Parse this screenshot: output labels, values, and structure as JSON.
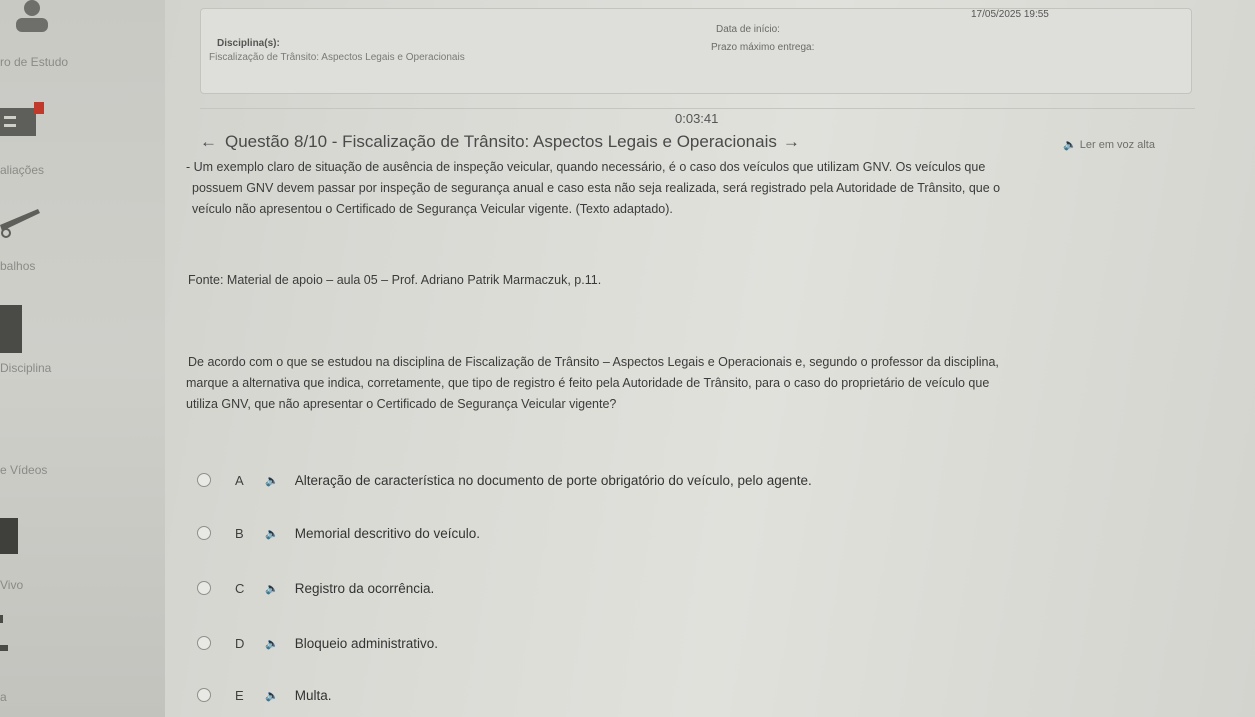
{
  "sidebar": {
    "items": [
      {
        "label": "ro de Estudo"
      },
      {
        "label": "aliações"
      },
      {
        "label": "balhos"
      },
      {
        "label": "Disciplina"
      },
      {
        "label": "e Vídeos"
      },
      {
        "label": "Vivo"
      },
      {
        "label": "a"
      }
    ]
  },
  "header": {
    "disciplina_label": "Disciplina(s):",
    "disciplina_value": "Fiscalização de Trânsito: Aspectos Legais e Operacionais",
    "data_inicio_label": "Data de início:",
    "data_inicio_value": "17/05/2025 19:55",
    "prazo_label": "Prazo máximo entrega:"
  },
  "timer": "0:03:41",
  "question": {
    "title": "Questão 8/10 - Fiscalização de Trânsito: Aspectos Legais e Operacionais",
    "read_aloud": "Ler em voz alta",
    "context_lines": [
      "- Um exemplo claro de situação de ausência de inspeção veicular, quando necessário, é o caso dos veículos que utilizam GNV. Os veículos que",
      "possuem GNV devem passar por inspeção de segurança anual e caso esta não seja realizada, será registrado pela Autoridade de Trânsito, que o",
      "veículo não apresentou o Certificado de Segurança Veicular vigente. (Texto adaptado)."
    ],
    "source": "Fonte: Material de apoio – aula 05 – Prof. Adriano Patrik Marmaczuk, p.11.",
    "prompt_lines": [
      "De acordo com o que se estudou na disciplina de Fiscalização de Trânsito – Aspectos Legais e Operacionais e, segundo o professor da disciplina,",
      "marque a alternativa que indica, corretamente, que tipo de registro é feito pela Autoridade de Trânsito, para o caso do proprietário de veículo que",
      "utiliza GNV, que não apresentar o Certificado de Segurança Veicular vigente?"
    ],
    "options": [
      {
        "letter": "A",
        "text": "Alteração de característica no documento de porte obrigatório do veículo, pelo agente."
      },
      {
        "letter": "B",
        "text": "Memorial descritivo do veículo."
      },
      {
        "letter": "C",
        "text": "Registro da ocorrência."
      },
      {
        "letter": "D",
        "text": "Bloqueio administrativo."
      },
      {
        "letter": "E",
        "text": "Multa."
      }
    ]
  }
}
